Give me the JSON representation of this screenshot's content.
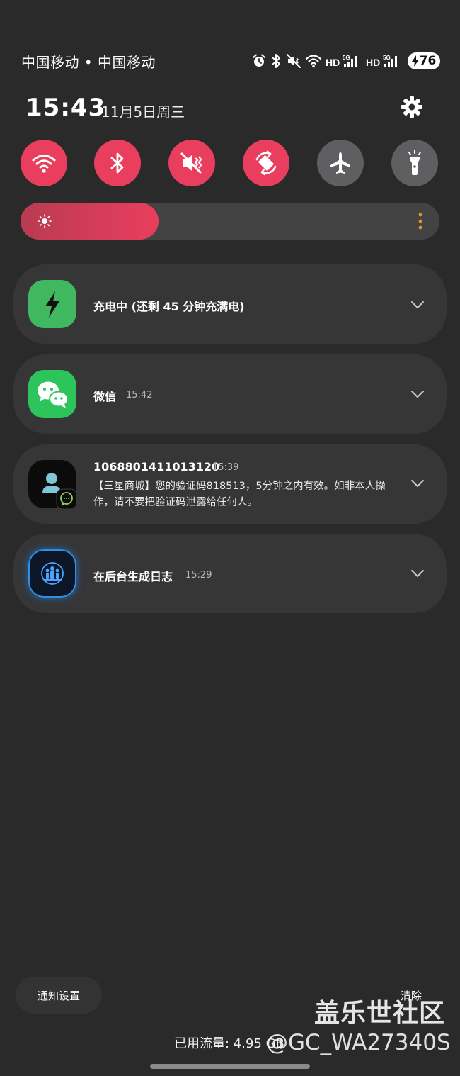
{
  "status_bar": {
    "carriers": "中国移动 • 中国移动",
    "battery_level": "76",
    "icons": [
      "alarm-icon",
      "bluetooth-icon",
      "vibrate-mute-icon",
      "wifi-icon",
      "signal-5g-hd-sim1-icon",
      "signal-5g-hd-sim2-icon",
      "battery-charging-icon"
    ]
  },
  "header": {
    "time": "15:43",
    "date": "11月5日周三",
    "settings_icon": "gear-icon"
  },
  "quick_settings": {
    "toggles": [
      {
        "name": "wifi",
        "icon": "wifi-icon",
        "active": true
      },
      {
        "name": "bluetooth",
        "icon": "bluetooth-icon",
        "active": true
      },
      {
        "name": "sound-mute",
        "icon": "mute-icon",
        "active": true
      },
      {
        "name": "auto-rotate",
        "icon": "rotate-icon",
        "active": true
      },
      {
        "name": "airplane-mode",
        "icon": "airplane-icon",
        "active": false
      },
      {
        "name": "flashlight",
        "icon": "flashlight-icon",
        "active": false
      }
    ],
    "active_color": "#e93e5e",
    "inactive_color": "#5f5f61",
    "brightness_level": 0.33
  },
  "notifications": [
    {
      "app": "charging",
      "icon": "bolt-icon",
      "title": "充电中 (还剩 45 分钟充满电)",
      "time": ""
    },
    {
      "app": "wechat",
      "icon": "wechat-icon",
      "title": "微信",
      "time": "15:42"
    },
    {
      "app": "messages",
      "icon": "contact-icon",
      "title": "1068801411013120",
      "time": "15:39",
      "body": "【三星商城】您的验证码818513，5分钟之内有效。如非本人操作，请不要把验证码泄露给任何人。"
    },
    {
      "app": "system-log",
      "icon": "people-log-icon",
      "title": "在后台生成日志",
      "time": "15:29"
    }
  ],
  "footer": {
    "notification_settings_label": "通知设置",
    "clear_label": "清除",
    "data_usage": "已用流量: 4.95 GB"
  },
  "watermark": {
    "line1": "盖乐世社区",
    "line2": "@GC_WA27340S"
  }
}
